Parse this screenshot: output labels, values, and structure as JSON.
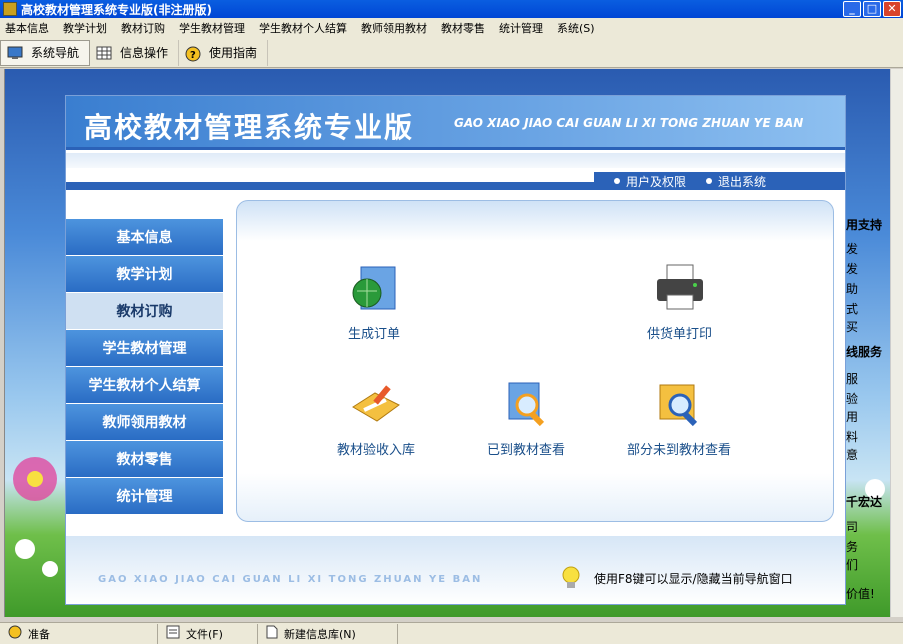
{
  "window": {
    "title": "高校教材管理系统专业版(非注册版)"
  },
  "menu": [
    "基本信息",
    "教学计划",
    "教材订购",
    "学生教材管理",
    "学生教材个人结算",
    "教师领用教材",
    "教材零售",
    "统计管理",
    "系统(S)"
  ],
  "toolbar": {
    "nav": "系统导航",
    "info": "信息操作",
    "help": "使用指南"
  },
  "header": {
    "title": "高校教材管理系统专业版",
    "pinyin": "GAO XIAO JIAO CAI GUAN LI XI TONG ZHUAN YE BAN"
  },
  "topnav": {
    "users": "用户及权限",
    "exit": "退出系统"
  },
  "sidebar": [
    "基本信息",
    "教学计划",
    "教材订购",
    "学生教材管理",
    "学生教材个人结算",
    "教师领用教材",
    "教材零售",
    "统计管理"
  ],
  "ops": {
    "gen_order": "生成订单",
    "print_supply": "供货单打印",
    "accept": "教材验收入库",
    "arrived": "已到教材查看",
    "not_arrived": "部分未到教材查看"
  },
  "footer": {
    "pinyin": "GAO XIAO JIAO CAI GUAN LI XI TONG ZHUAN YE BAN",
    "tip": "使用F8键可以显示/隐藏当前导航窗口"
  },
  "bg": {
    "h1": "用支持",
    "c1": "发",
    "c2": "发",
    "c3": "助",
    "c4": "式",
    "c5": "买",
    "h2": "线服务",
    "c6": "服",
    "c7": "验",
    "c8": "用",
    "c9": "料",
    "c10": "意",
    "h3": "千宏达",
    "c11": "司",
    "c12": "务",
    "c13": "们",
    "c14": "价值!"
  },
  "status": {
    "ready": "准备",
    "file": "文件(F)",
    "newdb": "新建信息库(N)"
  }
}
